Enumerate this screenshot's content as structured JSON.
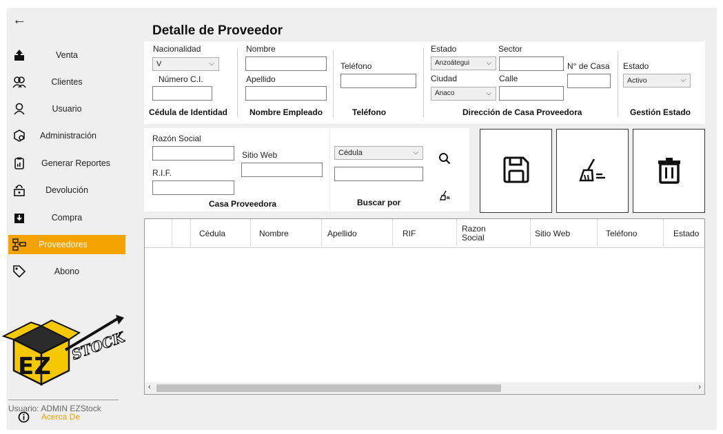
{
  "sidebar": {
    "back_label": "←",
    "items": [
      {
        "label": "Venta",
        "icon": "upload-icon"
      },
      {
        "label": "Clientes",
        "icon": "users-icon"
      },
      {
        "label": "Usuario",
        "icon": "user-icon"
      },
      {
        "label": "Administración",
        "icon": "gear-icon"
      },
      {
        "label": "Generar Reportes",
        "icon": "report-icon"
      },
      {
        "label": "Devolución",
        "icon": "return-icon"
      },
      {
        "label": "Compra",
        "icon": "download-icon"
      },
      {
        "label": "Proveedores",
        "icon": "supplier-icon"
      },
      {
        "label": "Abono",
        "icon": "tag-icon"
      }
    ],
    "active_index": 7,
    "logo_text": "STOCK",
    "logo_letters": "EZ",
    "user_text": "Usuario: ADMIN EZStock",
    "about_label": "Acerca De"
  },
  "main": {
    "title": "Detalle de Proveedor",
    "cedula_section": {
      "nacionalidad_label": "Nacionalidad",
      "nacionalidad_value": "V",
      "numero_ci_label": "Número C.I.",
      "numero_ci_value": "",
      "footer": "Cédula de Identidad"
    },
    "nombre_section": {
      "nombre_label": "Nombre",
      "nombre_value": "",
      "apellido_label": "Apellido",
      "apellido_value": "",
      "footer": "Nombre Empleado"
    },
    "telefono_section": {
      "telefono_label": "Teléfono",
      "telefono_value": "",
      "footer": "Teléfono"
    },
    "direccion_section": {
      "estado_label": "Estado",
      "estado_value": "Anzoátegui",
      "sector_label": "Sector",
      "sector_value": "",
      "ciudad_label": "Ciudad",
      "ciudad_value": "Anaco",
      "calle_label": "Calle",
      "calle_value": "",
      "numero_casa_label": "N° de Casa",
      "numero_casa_value": "",
      "footer": "Dirección de Casa Proveedora"
    },
    "gestion_section": {
      "estado_label": "Estado",
      "estado_value": "Activo",
      "footer": "Gestión Estado"
    },
    "casa_section": {
      "razon_label": "Razón Social",
      "razon_value": "",
      "sitio_label": "Sitio Web",
      "sitio_value": "",
      "rif_label": "R.I.F.",
      "rif_value": "",
      "footer": "Casa Proveedora"
    },
    "buscar_section": {
      "buscar_select": "Cédula",
      "buscar_value": "",
      "footer": "Buscar por"
    },
    "actions": {
      "save_icon": "save-icon",
      "clear_icon": "broom-icon",
      "delete_icon": "trash-icon"
    },
    "table": {
      "columns": [
        "",
        "",
        "Cédula",
        "Nombre",
        "Apellido",
        "RIF",
        "Razon Social",
        "Sitio Web",
        "Teléfono",
        "Estado"
      ],
      "rows": []
    }
  },
  "colors": {
    "accent": "#f5a300",
    "background": "#efefef",
    "panel": "#ffffff"
  }
}
